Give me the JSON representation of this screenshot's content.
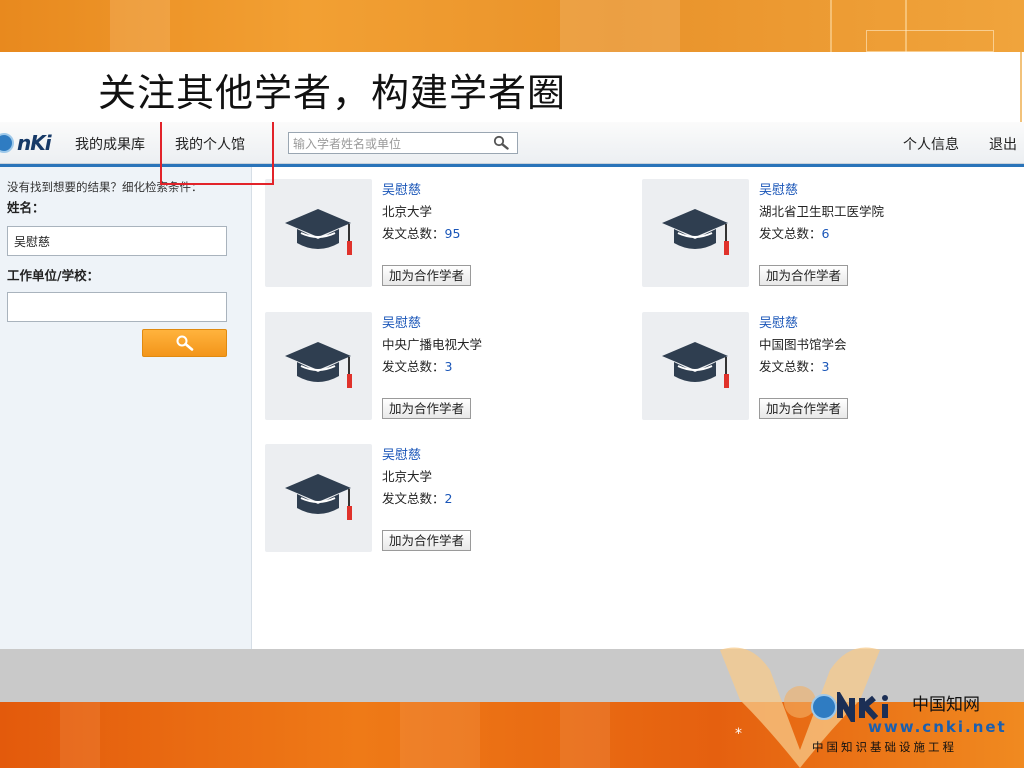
{
  "slide": {
    "title": "关注其他学者，构建学者圈",
    "slide_number": "*"
  },
  "nav": {
    "logo_text": "nKi",
    "items": [
      "我的成果库",
      "我的个人馆"
    ],
    "search_placeholder": "输入学者姓名或单位",
    "right_items": [
      "个人信息",
      "退出"
    ]
  },
  "sidebar": {
    "hint": "没有找到想要的结果？细化检索条件：",
    "name_label": "姓名：",
    "name_value": "吴慰慈",
    "org_label": "工作单位/学校：",
    "org_value": ""
  },
  "results": [
    {
      "name": "吴慰慈",
      "org": "北京大学",
      "count_label": "发文总数：",
      "count": "95",
      "button": "加为合作学者"
    },
    {
      "name": "吴慰慈",
      "org": "湖北省卫生职工医学院",
      "count_label": "发文总数：",
      "count": "6",
      "button": "加为合作学者"
    },
    {
      "name": "吴慰慈",
      "org": "中央广播电视大学",
      "count_label": "发文总数：",
      "count": "3",
      "button": "加为合作学者"
    },
    {
      "name": "吴慰慈",
      "org": "中国图书馆学会",
      "count_label": "发文总数：",
      "count": "3",
      "button": "加为合作学者"
    },
    {
      "name": "吴慰慈",
      "org": "北京大学",
      "count_label": "发文总数：",
      "count": "2",
      "button": "加为合作学者"
    }
  ],
  "footer": {
    "logo_cn": "中国知网",
    "logo_url": "www.cnki.net",
    "logo_sub": "中国知识基础设施工程"
  },
  "colors": {
    "accent_orange": "#f0a03a",
    "link_blue": "#1a56b8",
    "highlight_red": "#e2232a"
  }
}
